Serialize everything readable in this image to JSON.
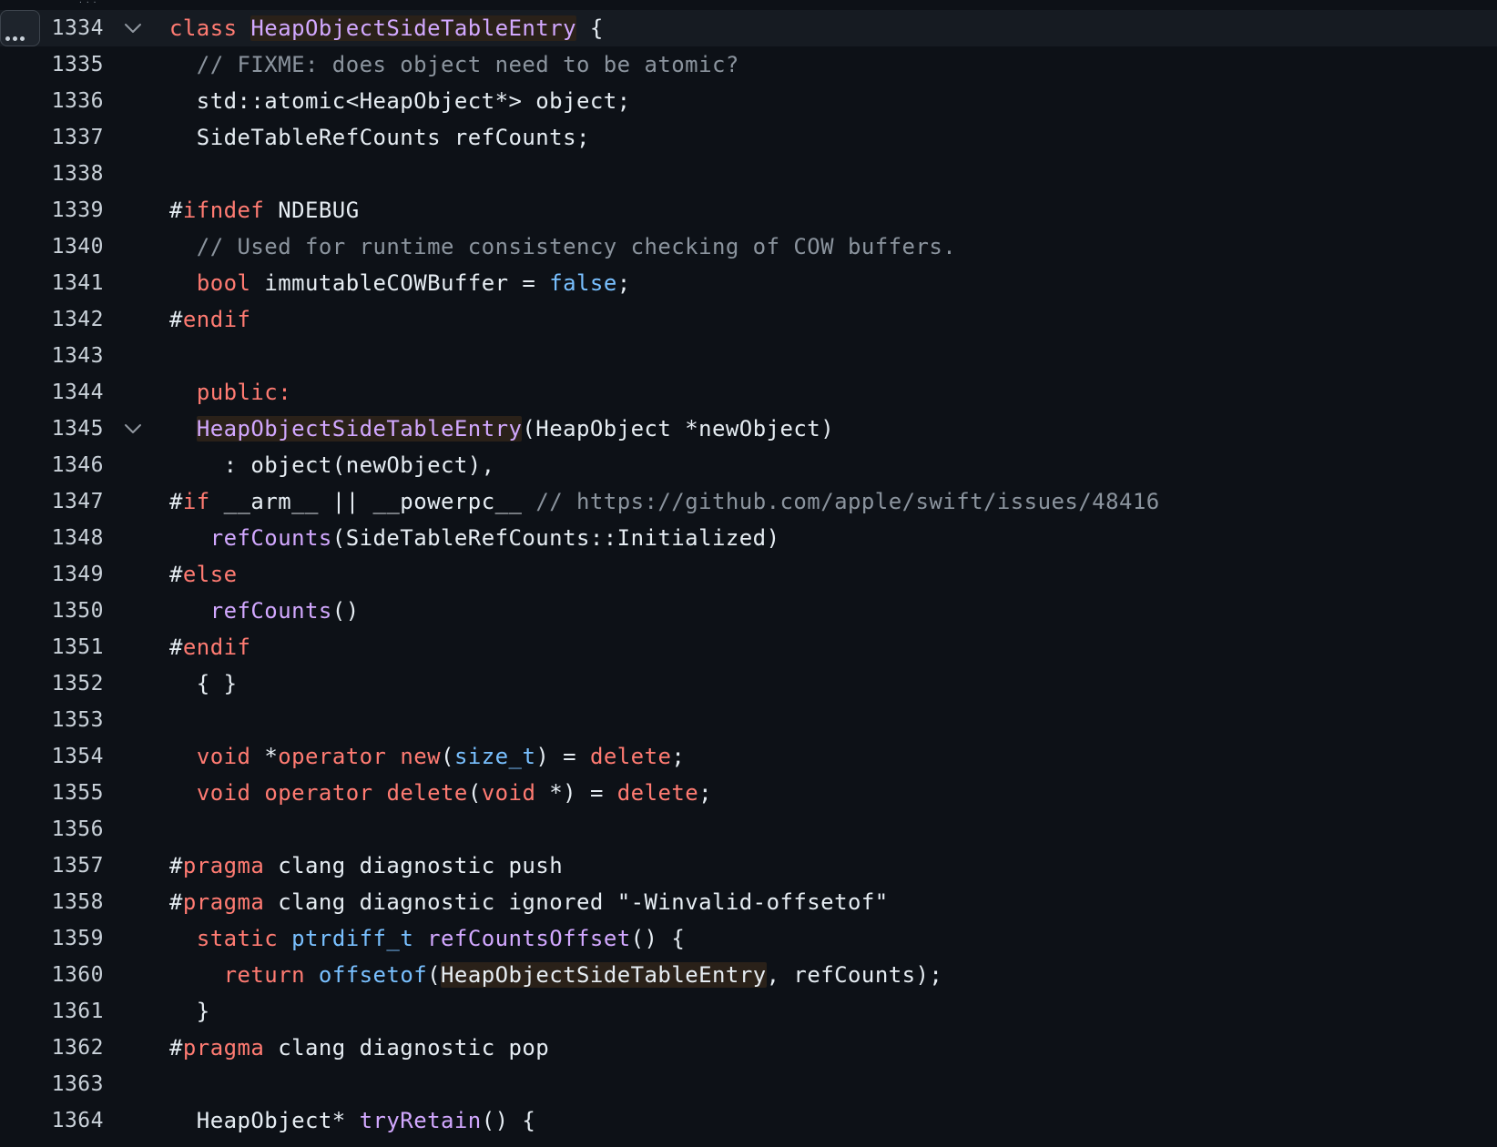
{
  "colors": {
    "background": "#0d1117",
    "keyword": "#ff7b72",
    "function": "#d2a8ff",
    "constant": "#79c0ff",
    "comment": "#8b949e",
    "plain": "#e6edf3",
    "highlight": "#2a2119",
    "active_line": "#161b22"
  },
  "toolbar": {
    "more_icon": "kebab-horizontal-icon",
    "fold_icon": "chevron-down-icon"
  },
  "lines": [
    {
      "number": "1334",
      "fold": true,
      "active": true,
      "tokens": [
        {
          "t": "class",
          "c": "kw"
        },
        {
          "t": " ",
          "c": "plain"
        },
        {
          "t": "HeapObjectSideTableEntry",
          "c": "fn",
          "hl": true
        },
        {
          "t": " {",
          "c": "plain"
        }
      ]
    },
    {
      "number": "1335",
      "tokens": [
        {
          "t": "  // FIXME: does object need to be atomic?",
          "c": "cm"
        }
      ]
    },
    {
      "number": "1336",
      "tokens": [
        {
          "t": "  std::atomic<HeapObject*> object;",
          "c": "plain"
        }
      ]
    },
    {
      "number": "1337",
      "tokens": [
        {
          "t": "  SideTableRefCounts refCounts;",
          "c": "plain"
        }
      ]
    },
    {
      "number": "1338",
      "tokens": []
    },
    {
      "number": "1339",
      "tokens": [
        {
          "t": "#",
          "c": "plain"
        },
        {
          "t": "ifndef",
          "c": "kw"
        },
        {
          "t": " NDEBUG",
          "c": "plain"
        }
      ]
    },
    {
      "number": "1340",
      "tokens": [
        {
          "t": "  // Used for runtime consistency checking of COW buffers.",
          "c": "cm"
        }
      ]
    },
    {
      "number": "1341",
      "tokens": [
        {
          "t": "  ",
          "c": "plain"
        },
        {
          "t": "bool",
          "c": "kw"
        },
        {
          "t": " immutableCOWBuffer = ",
          "c": "plain"
        },
        {
          "t": "false",
          "c": "const"
        },
        {
          "t": ";",
          "c": "plain"
        }
      ]
    },
    {
      "number": "1342",
      "tokens": [
        {
          "t": "#",
          "c": "plain"
        },
        {
          "t": "endif",
          "c": "kw"
        }
      ]
    },
    {
      "number": "1343",
      "tokens": []
    },
    {
      "number": "1344",
      "tokens": [
        {
          "t": "  ",
          "c": "plain"
        },
        {
          "t": "public:",
          "c": "kw"
        }
      ]
    },
    {
      "number": "1345",
      "fold": true,
      "tokens": [
        {
          "t": "  ",
          "c": "plain"
        },
        {
          "t": "HeapObjectSideTableEntry",
          "c": "fn",
          "hl": true
        },
        {
          "t": "(HeapObject *newObject)",
          "c": "plain"
        }
      ]
    },
    {
      "number": "1346",
      "tokens": [
        {
          "t": "    : object(newObject),",
          "c": "plain"
        }
      ]
    },
    {
      "number": "1347",
      "tokens": [
        {
          "t": "#",
          "c": "plain"
        },
        {
          "t": "if",
          "c": "kw"
        },
        {
          "t": " __arm__ || __powerpc__ ",
          "c": "plain"
        },
        {
          "t": "// https://github.com/apple/swift/issues/48416",
          "c": "cm"
        }
      ]
    },
    {
      "number": "1348",
      "tokens": [
        {
          "t": "   ",
          "c": "plain"
        },
        {
          "t": "refCounts",
          "c": "fn"
        },
        {
          "t": "(SideTableRefCounts::Initialized)",
          "c": "plain"
        }
      ]
    },
    {
      "number": "1349",
      "tokens": [
        {
          "t": "#",
          "c": "plain"
        },
        {
          "t": "else",
          "c": "kw"
        }
      ]
    },
    {
      "number": "1350",
      "tokens": [
        {
          "t": "   ",
          "c": "plain"
        },
        {
          "t": "refCounts",
          "c": "fn"
        },
        {
          "t": "()",
          "c": "plain"
        }
      ]
    },
    {
      "number": "1351",
      "tokens": [
        {
          "t": "#",
          "c": "plain"
        },
        {
          "t": "endif",
          "c": "kw"
        }
      ]
    },
    {
      "number": "1352",
      "tokens": [
        {
          "t": "  { }",
          "c": "plain"
        }
      ]
    },
    {
      "number": "1353",
      "tokens": []
    },
    {
      "number": "1354",
      "tokens": [
        {
          "t": "  ",
          "c": "plain"
        },
        {
          "t": "void",
          "c": "kw"
        },
        {
          "t": " *",
          "c": "plain"
        },
        {
          "t": "operator",
          "c": "kw"
        },
        {
          "t": " ",
          "c": "plain"
        },
        {
          "t": "new",
          "c": "kw"
        },
        {
          "t": "(",
          "c": "plain"
        },
        {
          "t": "size_t",
          "c": "const"
        },
        {
          "t": ") = ",
          "c": "plain"
        },
        {
          "t": "delete",
          "c": "kw"
        },
        {
          "t": ";",
          "c": "plain"
        }
      ]
    },
    {
      "number": "1355",
      "tokens": [
        {
          "t": "  ",
          "c": "plain"
        },
        {
          "t": "void",
          "c": "kw"
        },
        {
          "t": " ",
          "c": "plain"
        },
        {
          "t": "operator",
          "c": "kw"
        },
        {
          "t": " ",
          "c": "plain"
        },
        {
          "t": "delete",
          "c": "kw"
        },
        {
          "t": "(",
          "c": "plain"
        },
        {
          "t": "void",
          "c": "kw"
        },
        {
          "t": " *) = ",
          "c": "plain"
        },
        {
          "t": "delete",
          "c": "kw"
        },
        {
          "t": ";",
          "c": "plain"
        }
      ]
    },
    {
      "number": "1356",
      "tokens": []
    },
    {
      "number": "1357",
      "tokens": [
        {
          "t": "#",
          "c": "plain"
        },
        {
          "t": "pragma",
          "c": "kw"
        },
        {
          "t": " clang diagnostic push",
          "c": "plain"
        }
      ]
    },
    {
      "number": "1358",
      "tokens": [
        {
          "t": "#",
          "c": "plain"
        },
        {
          "t": "pragma",
          "c": "kw"
        },
        {
          "t": " clang diagnostic ignored \"-Winvalid-offsetof\"",
          "c": "plain"
        }
      ]
    },
    {
      "number": "1359",
      "tokens": [
        {
          "t": "  ",
          "c": "plain"
        },
        {
          "t": "static",
          "c": "kw"
        },
        {
          "t": " ",
          "c": "plain"
        },
        {
          "t": "ptrdiff_t",
          "c": "const"
        },
        {
          "t": " ",
          "c": "plain"
        },
        {
          "t": "refCountsOffset",
          "c": "fn"
        },
        {
          "t": "() {",
          "c": "plain"
        }
      ]
    },
    {
      "number": "1360",
      "tokens": [
        {
          "t": "    ",
          "c": "plain"
        },
        {
          "t": "return",
          "c": "kw"
        },
        {
          "t": " ",
          "c": "plain"
        },
        {
          "t": "offsetof",
          "c": "const"
        },
        {
          "t": "(",
          "c": "plain"
        },
        {
          "t": "HeapObjectSideTableEntry",
          "c": "plain",
          "hl": true
        },
        {
          "t": ", refCounts);",
          "c": "plain"
        }
      ]
    },
    {
      "number": "1361",
      "tokens": [
        {
          "t": "  }",
          "c": "plain"
        }
      ]
    },
    {
      "number": "1362",
      "tokens": [
        {
          "t": "#",
          "c": "plain"
        },
        {
          "t": "pragma",
          "c": "kw"
        },
        {
          "t": " clang diagnostic pop",
          "c": "plain"
        }
      ]
    },
    {
      "number": "1363",
      "tokens": []
    },
    {
      "number": "1364",
      "tokens": [
        {
          "t": "  HeapObject* ",
          "c": "plain"
        },
        {
          "t": "tryRetain",
          "c": "fn"
        },
        {
          "t": "() {",
          "c": "plain"
        }
      ]
    }
  ]
}
